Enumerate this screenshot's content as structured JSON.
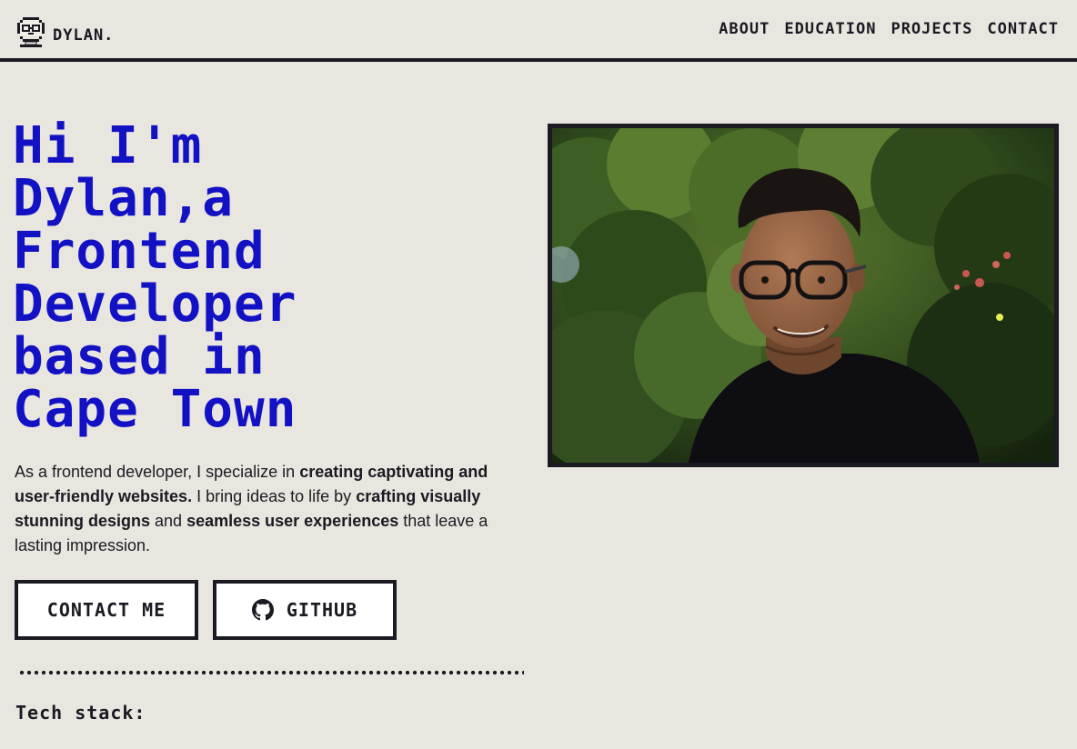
{
  "header": {
    "logo_text": "DYLAN.",
    "nav": [
      {
        "label": "ABOUT"
      },
      {
        "label": "EDUCATION"
      },
      {
        "label": "PROJECTS"
      },
      {
        "label": "CONTACT"
      }
    ]
  },
  "hero": {
    "title_lines": [
      "Hi I'm",
      "Dylan,a",
      "Frontend",
      "Developer",
      "based in",
      "Cape Town"
    ],
    "intro": {
      "p1": "As a frontend developer, I specialize in ",
      "b1": "creating captivating and user-friendly websites.",
      "p2": " I bring ideas to life by ",
      "b2": "crafting visually stunning designs",
      "p3": " and ",
      "b3": "seamless user experiences",
      "p4": " that leave a lasting impression."
    },
    "contact_button": "CONTACT ME",
    "github_button": "GITHUB",
    "tech_stack_heading": "Tech stack:"
  },
  "colors": {
    "background": "#e9e6df",
    "accent_blue": "#1311c4",
    "ink": "#1b1a22"
  },
  "icons": {
    "logo": "pixel-avatar-icon",
    "github": "github-icon"
  }
}
